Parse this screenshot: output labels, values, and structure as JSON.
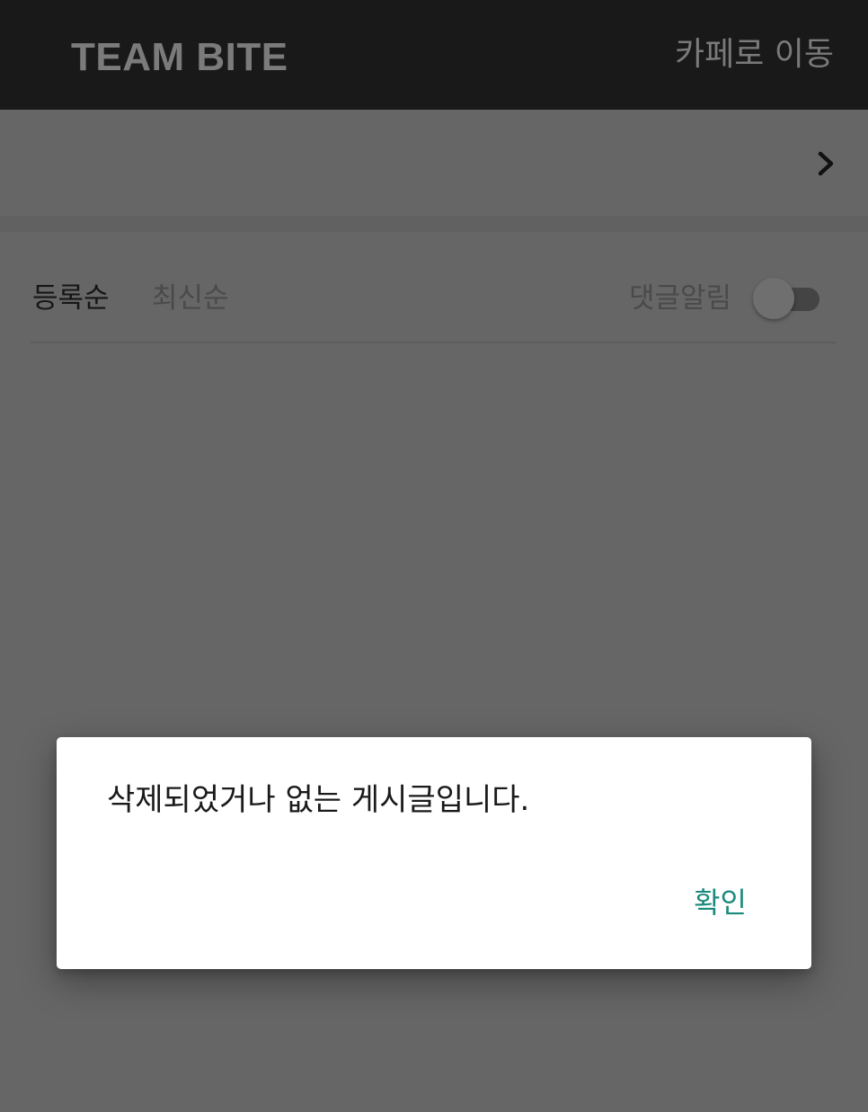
{
  "header": {
    "brand": "TEAM BITE",
    "go_to_cafe_label": "카페로 이동"
  },
  "board_row": {
    "chevron_icon": "chevron-right-icon"
  },
  "sort": {
    "registered_label": "등록순",
    "newest_label": "최신순",
    "active": "registered"
  },
  "comment_notification": {
    "label": "댓글알림",
    "enabled": false
  },
  "dialog": {
    "message": "삭제되었거나 없는 게시글입니다.",
    "confirm_label": "확인"
  },
  "colors": {
    "header_bg": "#191919",
    "overlay_bg": "#666666",
    "accent": "#1a8a7c"
  }
}
